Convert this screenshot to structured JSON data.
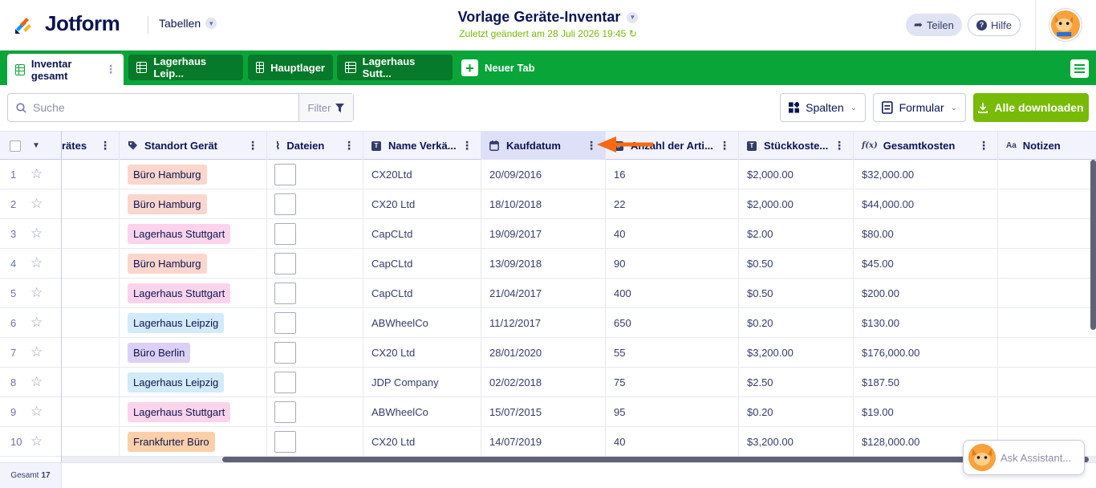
{
  "header": {
    "brand": "Jotform",
    "tables_label": "Tabellen",
    "doc_title": "Vorlage Geräte-Inventar",
    "doc_subtitle": "Zuletzt geändert am 28 Juli 2026 19:45",
    "share_label": "Teilen",
    "help_label": "Hilfe"
  },
  "tabs": [
    {
      "label": "Inventar gesamt",
      "active": true
    },
    {
      "label": "Lagerhaus Leip...",
      "active": false
    },
    {
      "label": "Hauptlager",
      "active": false
    },
    {
      "label": "Lagerhaus Sutt...",
      "active": false
    }
  ],
  "new_tab_label": "Neuer Tab",
  "toolbar": {
    "search_placeholder": "Suche",
    "filter_label": "Filter",
    "columns_label": "Spalten",
    "form_label": "Formular",
    "download_label": "Alle downloaden"
  },
  "columns": [
    {
      "label": "rätes",
      "icon": ""
    },
    {
      "label": "Standort Gerät",
      "icon": "tag-icon"
    },
    {
      "label": "Dateien",
      "icon": "paperclip-icon"
    },
    {
      "label": "Name Verkä...",
      "icon": "text-icon"
    },
    {
      "label": "Kaufdatum",
      "icon": "calendar-icon",
      "selected": true
    },
    {
      "label": "Anzahl der Arti...",
      "icon": "number-icon"
    },
    {
      "label": "Stückkoste...",
      "icon": "text-icon"
    },
    {
      "label": "Gesamtkosten",
      "icon": "formula-icon"
    },
    {
      "label": "Notizen",
      "icon": "longtext-icon"
    }
  ],
  "column_icon_glyphs": {
    "text": "T",
    "formula": "f(x)",
    "longtext": "Aa"
  },
  "rows": [
    {
      "n": "1",
      "location": "Büro Hamburg",
      "tag_color": "#fbd6cc",
      "vendor": "CX20Ltd",
      "date": "20/09/2016",
      "qty": "16",
      "unit": "$2,000.00",
      "total": "$32,000.00"
    },
    {
      "n": "2",
      "location": "Büro Hamburg",
      "tag_color": "#fbd6cc",
      "vendor": "CX20 Ltd",
      "date": "18/10/2018",
      "qty": "22",
      "unit": "$2,000.00",
      "total": "$44,000.00"
    },
    {
      "n": "3",
      "location": "Lagerhaus Stuttgart",
      "tag_color": "#fbd4ec",
      "vendor": "CapCLtd",
      "date": "19/09/2017",
      "qty": "40",
      "unit": "$2.00",
      "total": "$80.00"
    },
    {
      "n": "4",
      "location": "Büro Hamburg",
      "tag_color": "#fbd6cc",
      "vendor": "CapCLtd",
      "date": "13/09/2018",
      "qty": "90",
      "unit": "$0.50",
      "total": "$45.00"
    },
    {
      "n": "5",
      "location": "Lagerhaus Stuttgart",
      "tag_color": "#fbd4ec",
      "vendor": "CapCLtd",
      "date": "21/04/2017",
      "qty": "400",
      "unit": "$0.50",
      "total": "$200.00"
    },
    {
      "n": "6",
      "location": "Lagerhaus Leipzig",
      "tag_color": "#d2eafa",
      "vendor": "ABWheelCo",
      "date": "11/12/2017",
      "qty": "650",
      "unit": "$0.20",
      "total": "$130.00"
    },
    {
      "n": "7",
      "location": "Büro Berlin",
      "tag_color": "#ddd0f5",
      "vendor": "CX20 Ltd",
      "date": "28/01/2020",
      "qty": "55",
      "unit": "$3,200.00",
      "total": "$176,000.00"
    },
    {
      "n": "8",
      "location": "Lagerhaus Leipzig",
      "tag_color": "#d2eafa",
      "vendor": "JDP Company",
      "date": "02/02/2018",
      "qty": "75",
      "unit": "$2.50",
      "total": "$187.50"
    },
    {
      "n": "9",
      "location": "Lagerhaus Stuttgart",
      "tag_color": "#fbd4ec",
      "vendor": "ABWheelCo",
      "date": "15/07/2015",
      "qty": "95",
      "unit": "$0.20",
      "total": "$19.00"
    },
    {
      "n": "10",
      "location": "Frankfurter Büro",
      "tag_color": "#fbd0a8",
      "vendor": "CX20 Ltd",
      "date": "14/07/2019",
      "qty": "40",
      "unit": "$3,200.00",
      "total": "$128,000.00"
    }
  ],
  "footer": {
    "total_label": "Gesamt",
    "total_count": "17"
  },
  "assistant_label": "Ask Assistant...",
  "colors": {
    "brand_green": "#09a538",
    "download_green": "#78bb07",
    "arrow": "#f56a12"
  }
}
